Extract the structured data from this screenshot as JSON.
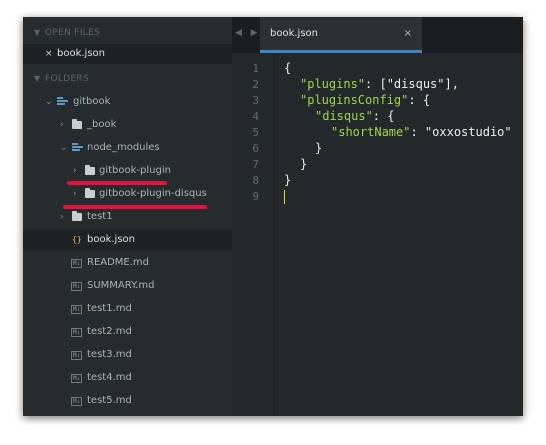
{
  "sidebar": {
    "open_files_header": "OPEN FILES",
    "open_files": [
      {
        "close_glyph": "×",
        "label": "book.json"
      }
    ],
    "folders_header": "FOLDERS",
    "tree": {
      "root": "gitbook",
      "book_dir": "_book",
      "node_modules": "node_modules",
      "plugin1": "gitbook-plugin",
      "plugin2": "gitbook-plugin-disqus",
      "test1_dir": "test1",
      "files": [
        "book.json",
        "README.md",
        "SUMMARY.md",
        "test1.md",
        "test2.md",
        "test3.md",
        "test4.md",
        "test5.md"
      ]
    },
    "md_badge": "M↓",
    "json_badge": "{}"
  },
  "annotations": {
    "underline_color": "#e2143f"
  },
  "tabbar": {
    "nav": "◀ ▶",
    "tab_title": "book.json",
    "tab_close": "×"
  },
  "editor": {
    "line_numbers": [
      "1",
      "2",
      "3",
      "4",
      "5",
      "6",
      "7",
      "8",
      "9"
    ],
    "code": {
      "l1": "{",
      "l2_key": "\"plugins\"",
      "l2_rest": ": [\"disqus\"],",
      "l3_key": "\"pluginsConfig\"",
      "l3_rest": ": {",
      "l4_key": "\"disqus\"",
      "l4_rest": ": {",
      "l5_key": "\"shortName\"",
      "l5_rest": ": \"oxxostudio\"",
      "l6": "}",
      "l7": "}",
      "l8": "}"
    }
  },
  "colors": {
    "key": "#a2d64b",
    "accent_tab": "#3f87c6",
    "cursor": "#e8d44d"
  }
}
